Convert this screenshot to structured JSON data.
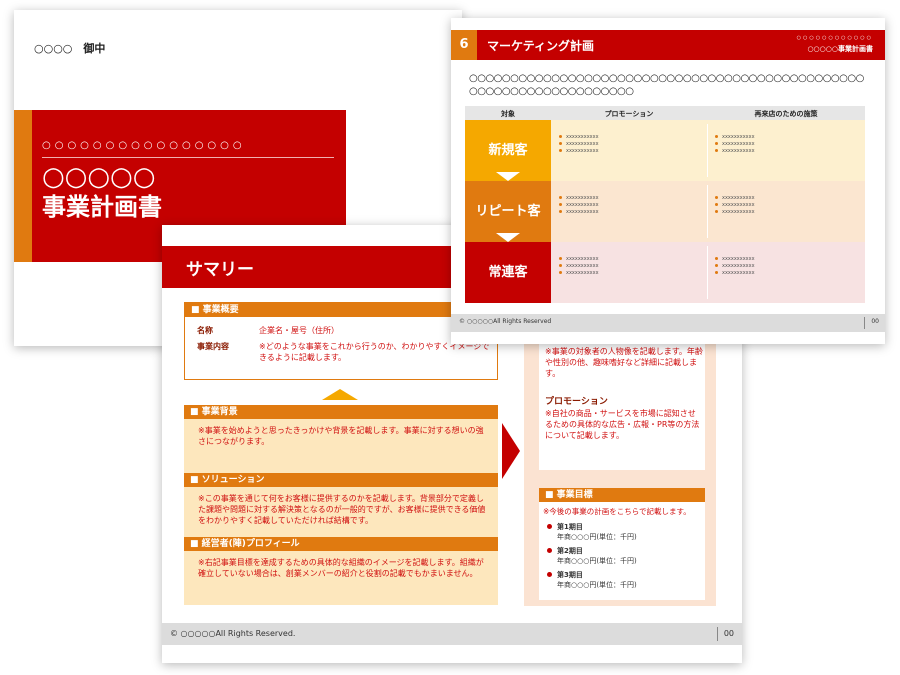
{
  "cover": {
    "addressee": "○○○○　御中",
    "dots": "○○○○○○○○○○○○○○○○",
    "title_line1": "○○○○○",
    "title_line2": "事業計画書"
  },
  "summary": {
    "title": "サマリー",
    "overview": {
      "header": "■ 事業概要",
      "name_label": "名称",
      "name_value": "企業名・屋号（住所）",
      "content_label": "事業内容",
      "content_value": "※どのような事業をこれから行うのか、わかりやすくイメージできるように記載します。"
    },
    "background": {
      "header": "■ 事業背景",
      "text": "※事業を始めようと思ったきっかけや背景を記載します。事業に対する想いの強さにつながります。"
    },
    "solution": {
      "header": "■ ソリューション",
      "text": "※この事業を通じて何をお客様に提供するのかを記載します。背景部分で定義した課題や問題に対する解決策となるのが一般的ですが、お客様に提供できる価値をわかりやすく記載していただければ結構です。"
    },
    "profile": {
      "header": "■ 経営者(陣)プロフィール",
      "text": "※右記事業目標を達成するための具体的な組織のイメージを記載します。組織が確立していない場合は、創業メンバーの紹介と役割の記載でもかまいません。"
    },
    "target_text": "※事業の対象者の人物像を記載します。年齢や性別の他、趣味嗜好など詳細に記載します。",
    "promotion": {
      "header": "プロモーション",
      "text": "※自社の商品・サービスを市場に認知させるための具体的な広告・広報・PR等の方法について記載します。"
    },
    "goal": {
      "header": "■ 事業目標",
      "intro": "※今後の事業の計画をこちらで記載します。",
      "items": [
        {
          "term": "第1期目",
          "value": "年商○○○円(単位：千円)"
        },
        {
          "term": "第2期目",
          "value": "年商○○○円(単位：千円)"
        },
        {
          "term": "第3期目",
          "value": "年商○○○円(単位：千円)"
        }
      ]
    },
    "footer": {
      "copyright": "© ○○○○○All Rights Reserved.",
      "page": "00"
    }
  },
  "marketing": {
    "number": "6",
    "title": "マーケティング計画",
    "tr_dots": "○○○○○○○○○○○○",
    "tr_label": "○○○○○事業計画書",
    "lead": "○○○○○○○○○○○○○○○○○○○○○○○○○○○○○○○○○○○○○○○○○○○○○○○○○○○○○○○○○○○○○○○○○○○○",
    "headers": {
      "target": "対象",
      "promotion": "プロモーション",
      "measure": "再来店のための施策"
    },
    "rows": [
      {
        "segment": "新規客",
        "color": "#f5a800",
        "bg": "#fdf0cf"
      },
      {
        "segment": "リピート客",
        "color": "#e07a10",
        "bg": "#fbe6d0"
      },
      {
        "segment": "常連客",
        "color": "#c40000",
        "bg": "#f7e2e2"
      }
    ],
    "bullet": "xxxxxxxxxxx",
    "footer": {
      "copyright": "© ○○○○○All Rights Reserved",
      "page": "00"
    }
  }
}
